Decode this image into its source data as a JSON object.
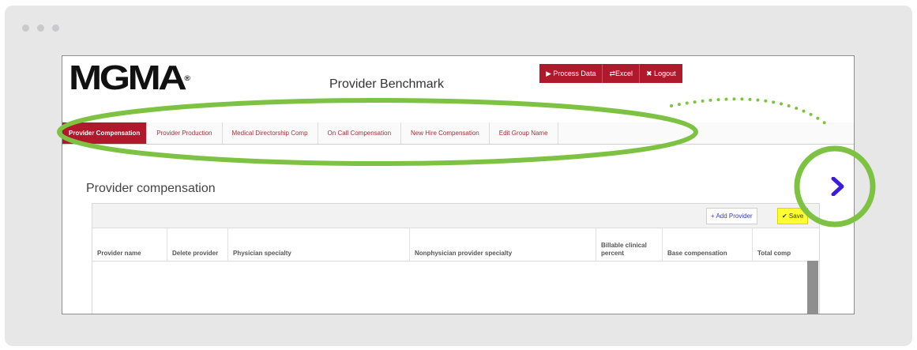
{
  "app": {
    "logo_text": "MGMA",
    "logo_mark": "®",
    "title": "Provider Benchmark"
  },
  "toolbar": {
    "process_label": "▶ Process Data",
    "excel_label": "⇄Excel",
    "logout_label": "✖ Logout"
  },
  "tabs": [
    {
      "label": "Provider Compensation",
      "active": true
    },
    {
      "label": "Provider Production"
    },
    {
      "label": "Medical Directorship Comp"
    },
    {
      "label": "On Call Compensation"
    },
    {
      "label": "New Hire Compensation"
    },
    {
      "label": "Edit Group Name"
    }
  ],
  "section": {
    "title": "Provider compensation"
  },
  "grid": {
    "add_label": "+ Add Provider",
    "save_label": "✔ Save",
    "columns": [
      "Provider name",
      "Delete provider",
      "Physician specialty",
      "Nonphysician provider specialty",
      "Billable clinical percent",
      "Base compensation",
      "Total comp"
    ]
  },
  "icons": {
    "next": "chevron-right-icon"
  },
  "colors": {
    "brand_red": "#b0182b",
    "highlight_green": "#7dc242",
    "arrow_purple": "#3b1de0",
    "save_yellow": "#ffff33"
  }
}
